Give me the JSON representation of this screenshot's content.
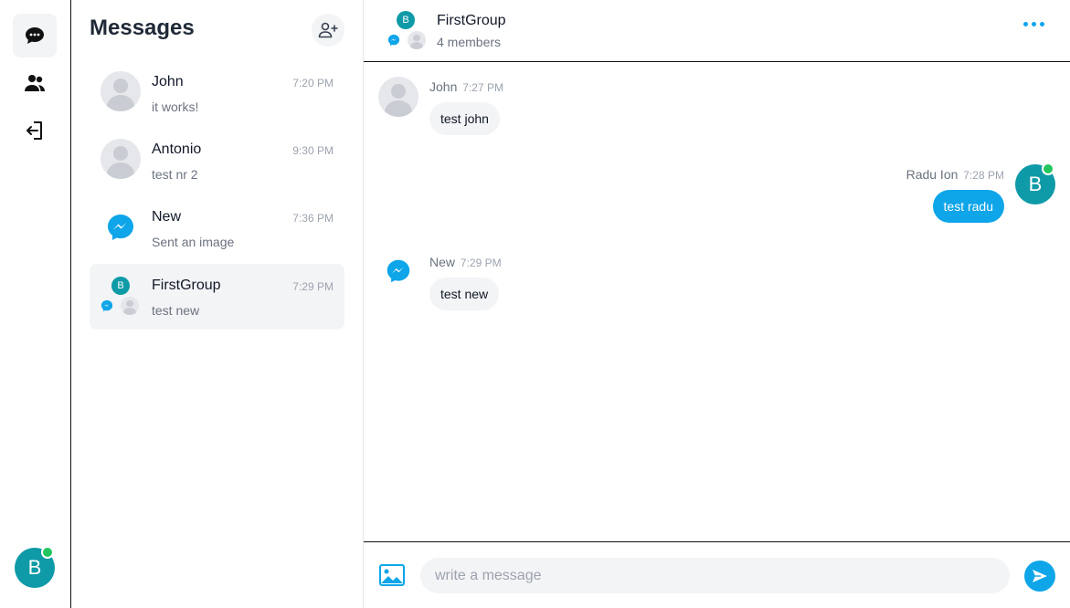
{
  "rail": {
    "user_initial": "B",
    "items": [
      {
        "name": "chats",
        "icon": "chat-bubble-icon",
        "active": true
      },
      {
        "name": "people",
        "icon": "people-icon",
        "active": false
      },
      {
        "name": "logout",
        "icon": "logout-icon",
        "active": false
      }
    ]
  },
  "list": {
    "title": "Messages",
    "add_icon": "add-user-icon",
    "conversations": [
      {
        "name": "John",
        "time": "7:20 PM",
        "preview": "it works!",
        "avatar": "person"
      },
      {
        "name": "Antonio",
        "time": "9:30 PM",
        "preview": "test nr 2",
        "avatar": "person"
      },
      {
        "name": "New",
        "time": "7:36 PM",
        "preview": "Sent an image",
        "avatar": "messenger"
      },
      {
        "name": "FirstGroup",
        "time": "7:29 PM",
        "preview": "test new",
        "avatar": "group",
        "group_initial": "B",
        "active": true
      }
    ]
  },
  "chat": {
    "title": "FirstGroup",
    "subtitle": "4 members",
    "group_initial": "B",
    "more_icon": "more-dots-icon",
    "messages": [
      {
        "sender": "John",
        "time": "7:27 PM",
        "text": "test john",
        "mine": false,
        "avatar": "person"
      },
      {
        "sender": "Radu Ion",
        "time": "7:28 PM",
        "text": "test radu",
        "mine": true,
        "avatar_initial": "B"
      },
      {
        "sender": "New",
        "time": "7:29 PM",
        "text": "test new",
        "mine": false,
        "avatar": "messenger"
      }
    ],
    "composer": {
      "placeholder": "write a message",
      "value": ""
    }
  },
  "colors": {
    "accent": "#0ea5e9",
    "avatar": "#0e9aa7",
    "online": "#22c55e"
  }
}
